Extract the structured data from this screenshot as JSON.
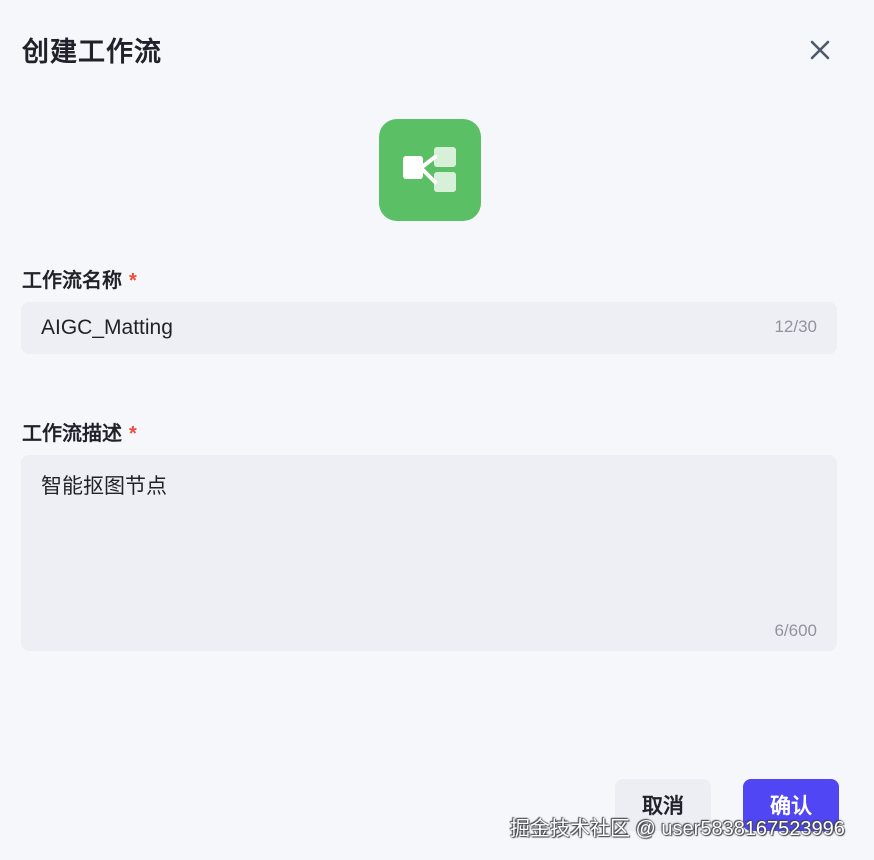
{
  "dialog": {
    "title": "创建工作流",
    "close_icon": "close-icon"
  },
  "icon": {
    "name": "workflow-icon",
    "color": "#5bbf65"
  },
  "fields": {
    "name": {
      "label": "工作流名称",
      "required_mark": "*",
      "value": "AIGC_Matting",
      "counter": "12/30"
    },
    "description": {
      "label": "工作流描述",
      "required_mark": "*",
      "value": "智能抠图节点",
      "counter": "6/600"
    }
  },
  "buttons": {
    "cancel": "取消",
    "confirm": "确认"
  },
  "colors": {
    "accent": "#5046f4",
    "required": "#f04b3a",
    "background": "#f6f7fb",
    "input_bg": "#eeeff4"
  },
  "watermark": "掘金技术社区 @ user5838167523996"
}
